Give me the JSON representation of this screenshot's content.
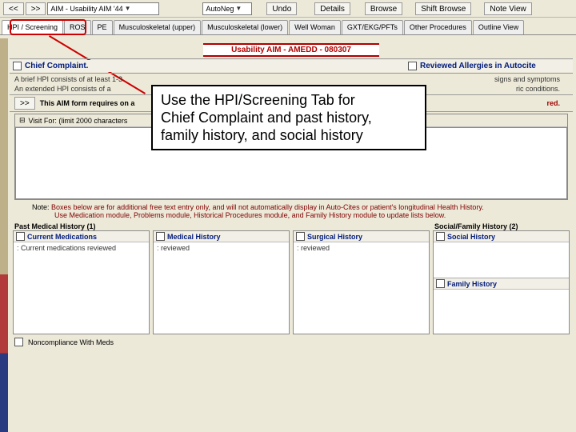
{
  "toolbar": {
    "back_label": "<<",
    "fwd_label": ">>",
    "combo_value": "AIM - Usability AIM '44",
    "autoneg_label": "AutoNeg",
    "undo_label": "Undo",
    "details_label": "Details",
    "browse_label": "Browse",
    "shift_browse_label": "Shift Browse",
    "note_view_label": "Note View"
  },
  "tabs": [
    {
      "label": "HPI / Screening"
    },
    {
      "label": "ROS"
    },
    {
      "label": "PE"
    },
    {
      "label": "Musculoskeletal (upper)"
    },
    {
      "label": "Musculoskeletal (lower)"
    },
    {
      "label": "Well Woman"
    },
    {
      "label": "GXT/EKG/PFTs"
    },
    {
      "label": "Other Procedures"
    },
    {
      "label": "Outline View"
    }
  ],
  "banner": "Usability AIM - AMEDD - 080307",
  "chief": {
    "title": "Chief Complaint.",
    "line1": "A brief HPI consists of at least 1-3",
    "line2": "An extended HPI consists of a",
    "form_note": "This AIM form requires on a",
    "req_tail": "red."
  },
  "reviewed": {
    "title": "Reviewed Allergies in Autocite",
    "sub1": "signs and symptoms",
    "sub2": "ric conditions."
  },
  "visit": {
    "title": "Visit For: (limit 2000 characters"
  },
  "callout": {
    "l1": "Use the HPI/Screening Tab for",
    "l2": "Chief Complaint and past history,",
    "l3": "family history, and social history"
  },
  "note": {
    "label": "Note:",
    "l1": "Boxes below are for additional free text entry only, and will not automatically display in Auto-Cites or patient's longitudinal Health History.",
    "l2": "Use Medication module, Problems module, Historical Procedures module, and Family History module to update lists below."
  },
  "pmh_title": "Past Medical History (1)",
  "sfh_title": "Social/Family History (2)",
  "panels": {
    "meds": {
      "title": "Current Medications",
      "body": ": Current medications reviewed"
    },
    "medhx": {
      "title": "Medical History",
      "body": ": reviewed"
    },
    "surg": {
      "title": "Surgical History",
      "body": ": reviewed"
    },
    "social": {
      "title": "Social History",
      "body": ""
    },
    "family": {
      "title": "Family History",
      "body": ""
    }
  },
  "noncomp": "Noncompliance With Meds"
}
